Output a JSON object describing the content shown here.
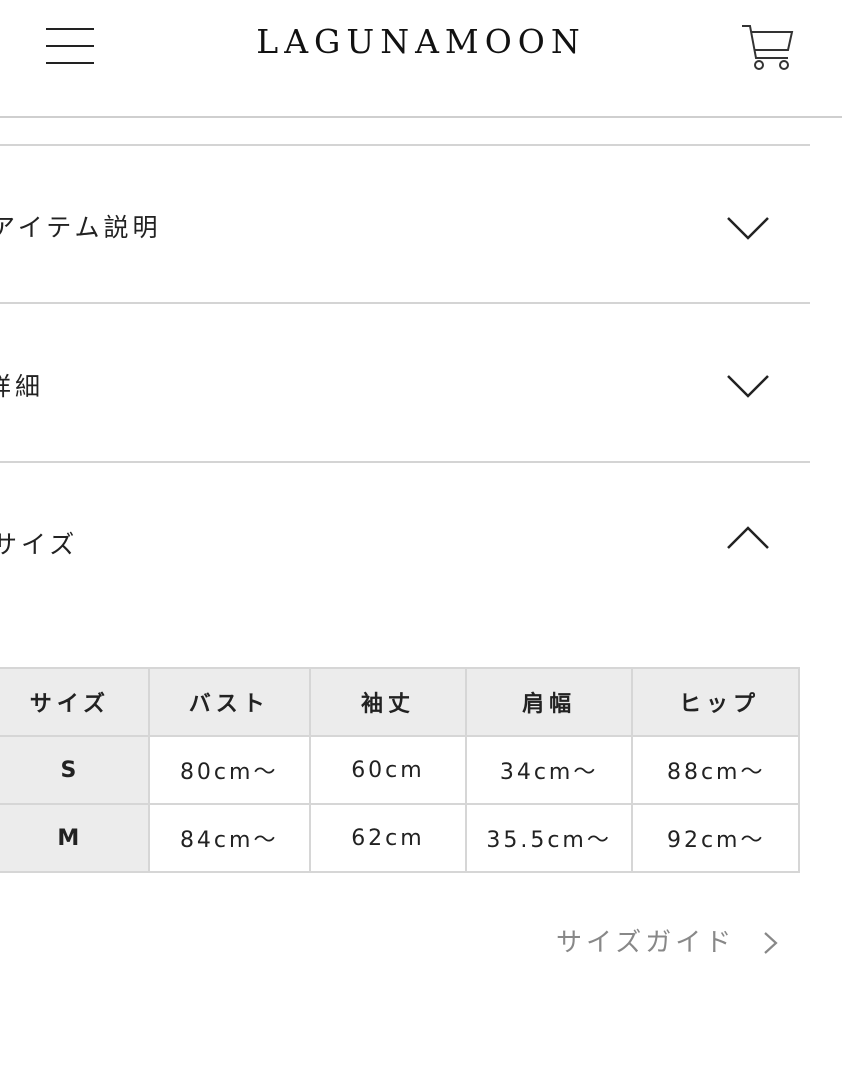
{
  "header": {
    "brand": "LAGUNAMOON",
    "menu_icon": "hamburger-menu-icon",
    "cart_icon": "shopping-cart-icon"
  },
  "accordion": {
    "items": [
      {
        "label": "アイテム説明",
        "state": "collapsed",
        "icon": "chevron-down-icon"
      },
      {
        "label": "詳細",
        "state": "collapsed",
        "icon": "chevron-down-icon"
      },
      {
        "label": "サイズ",
        "state": "expanded",
        "icon": "chevron-up-icon"
      }
    ]
  },
  "size_table": {
    "headers": [
      "サイズ",
      "バスト",
      "袖丈",
      "肩幅",
      "ヒップ"
    ],
    "rows": [
      [
        "S",
        "80cm〜",
        "60cm",
        "34cm〜",
        "88cm〜"
      ],
      [
        "M",
        "84cm〜",
        "62cm",
        "35.5cm〜",
        "92cm〜"
      ]
    ]
  },
  "size_guide": {
    "label": "サイズガイド",
    "icon": "chevron-right-icon"
  },
  "colors": {
    "divider": "#d4d4d4",
    "table_header_bg": "#ececec",
    "link_gray": "#888888"
  }
}
